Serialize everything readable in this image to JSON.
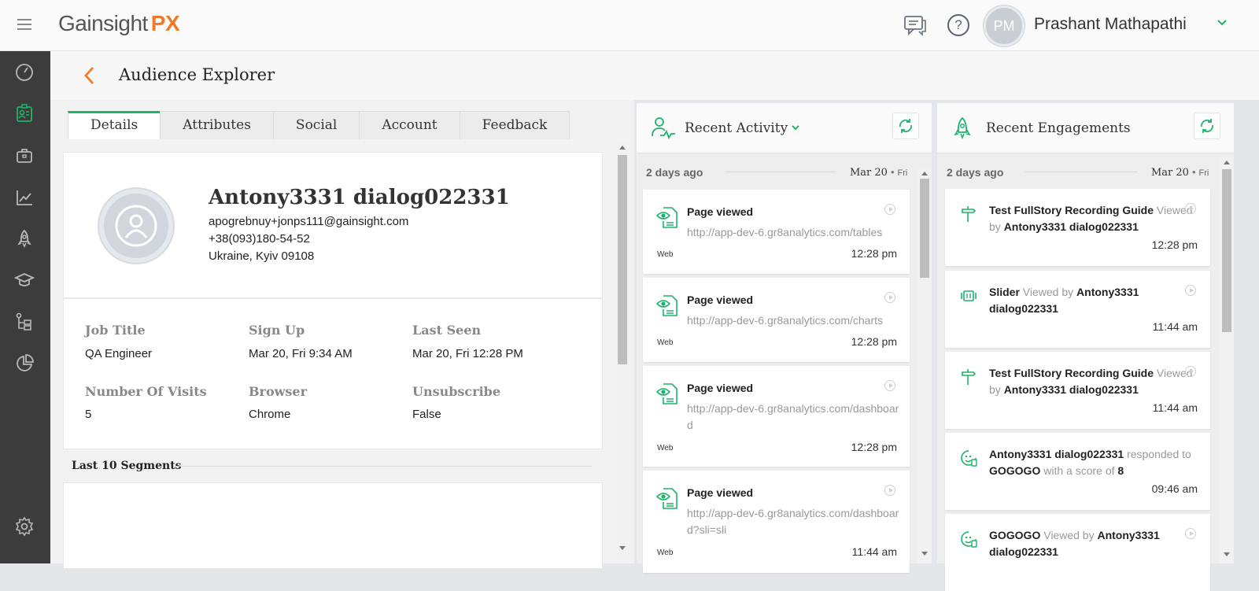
{
  "header": {
    "logo_main": "Gainsight",
    "logo_accent": "PX",
    "user_initials": "PM",
    "user_name": "Prashant Mathapathi"
  },
  "colors": {
    "accent_green": "#1eb36b",
    "brand_orange": "#ef7a2a",
    "nav_bg": "#3c3c3c"
  },
  "nav": [
    "dashboard-icon",
    "audience-icon",
    "briefcase-icon",
    "analytics-icon",
    "rocket-icon",
    "graduation-cap-icon",
    "hierarchy-icon",
    "pie-chart-icon",
    "settings-icon"
  ],
  "page": {
    "title": "Audience Explorer"
  },
  "tabs": [
    "Details",
    "Attributes",
    "Social",
    "Account",
    "Feedback"
  ],
  "profile": {
    "name": "Antony3331 dialog022331",
    "email": "apogrebnuy+jonps111@gainsight.com",
    "phone": "+38(093)180-54-52",
    "location": "Ukraine, Kyiv 09108"
  },
  "fields": [
    {
      "label": "Job Title",
      "value": "QA Engineer"
    },
    {
      "label": "Sign Up",
      "value": "Mar 20, Fri 9:34 AM"
    },
    {
      "label": "Last Seen",
      "value": "Mar 20, Fri 12:28 PM"
    },
    {
      "label": "Number Of Visits",
      "value": "5"
    },
    {
      "label": "Browser",
      "value": "Chrome"
    },
    {
      "label": "Unsubscribe",
      "value": "False"
    }
  ],
  "segments": {
    "title": "Last 10 Segments"
  },
  "recent_activity": {
    "title": "Recent Activity",
    "date_relative": "2 days ago",
    "date_absolute": "Mar 20",
    "date_day": "Fri",
    "items": [
      {
        "title": "Page viewed",
        "url": "http://app-dev-6.gr8analytics.com/tables",
        "channel": "Web",
        "time": "12:28 pm"
      },
      {
        "title": "Page viewed",
        "url": "http://app-dev-6.gr8analytics.com/charts",
        "channel": "Web",
        "time": "12:28 pm"
      },
      {
        "title": "Page viewed",
        "url": "http://app-dev-6.gr8analytics.com/dashboard",
        "channel": "Web",
        "time": "12:28 pm"
      },
      {
        "title": "Page viewed",
        "url": "http://app-dev-6.gr8analytics.com/dashboard?sli=sli",
        "channel": "Web",
        "time": "11:44 am"
      }
    ]
  },
  "recent_engagements": {
    "title": "Recent Engagements",
    "date_relative": "2 days ago",
    "date_absolute": "Mar 20",
    "date_day": "Fri",
    "items": [
      {
        "icon": "guide-icon",
        "subject": "Test FullStory Recording Guide",
        "verb": "Viewed by",
        "actor": "Antony3331 dialog022331",
        "time": "12:28 pm"
      },
      {
        "icon": "slider-icon",
        "subject": "Slider",
        "verb": "Viewed by",
        "actor": "Antony3331 dialog022331",
        "time": "11:44 am"
      },
      {
        "icon": "guide-icon",
        "subject": "Test FullStory Recording Guide",
        "verb": "Viewed by",
        "actor": "Antony3331 dialog022331",
        "time": "11:44 am"
      },
      {
        "icon": "survey-icon",
        "subject": "Antony3331 dialog022331",
        "verb": "responded to",
        "target": "GOGOGO",
        "score_text": "with a score of",
        "score": "8",
        "time": "09:46 am"
      },
      {
        "icon": "survey-icon",
        "subject": "GOGOGO",
        "verb": "Viewed by",
        "actor": "Antony3331 dialog022331",
        "time": ""
      }
    ]
  }
}
